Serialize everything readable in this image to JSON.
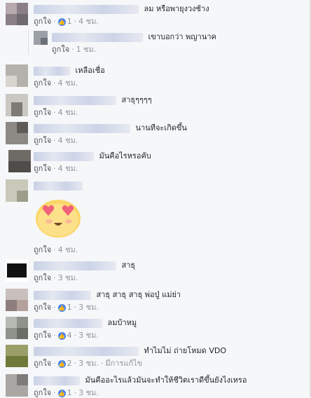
{
  "comments": [
    {
      "id": "c1",
      "text": "ลม หรือพายุงวงช้าง",
      "like": "ถูกใจ",
      "reactions": "1",
      "time": "4 ชม."
    },
    {
      "id": "c1r",
      "text": "เขาบอกว่า พญานาค",
      "like": "ถูกใจ",
      "time": "1 ชม."
    },
    {
      "id": "c2",
      "text": "เหลือเชื่อ",
      "like": "ถูกใจ",
      "time": "4 ชม."
    },
    {
      "id": "c3",
      "text": "สาธุๆๆๆๆ",
      "like": "ถูกใจ",
      "time": "4 ชม."
    },
    {
      "id": "c4",
      "text": "นานทีจะเกิดขึ้น",
      "like": "ถูกใจ",
      "time": "4 ชม."
    },
    {
      "id": "c5",
      "text": "มันคือไรหรอคับ",
      "like": "ถูกใจ",
      "time": "4 ชม."
    },
    {
      "id": "c6",
      "text": "",
      "like": "ถูกใจ",
      "time": "4 ชม.",
      "sticker": "heart-eyes-emoji"
    },
    {
      "id": "c7",
      "text": "สาธุ",
      "like": "ถูกใจ",
      "time": "3 ชม."
    },
    {
      "id": "c8",
      "text": "สาธุ สาธุ สาธุ พ่อปู่ แม่ย่า",
      "like": "ถูกใจ",
      "reactions": "1",
      "time": "3 ชม."
    },
    {
      "id": "c9",
      "text": "ลมบ้าหมู",
      "like": "ถูกใจ",
      "reactions": "4",
      "time": "3 ชม."
    },
    {
      "id": "c10",
      "text": "ทำไมไม่ ถ่ายโหมด VDO",
      "like": "ถูกใจ",
      "reactions": "2",
      "time": "3 ชม.",
      "edited": "มีการแก้ไข"
    },
    {
      "id": "c11",
      "text": "มันคืออะไรแล้วมันจะทำให้ชีวิตเราดีขึ้นยังไงเหรอ",
      "like": "ถูกใจ",
      "reactions": "1",
      "time": "3 ชม."
    }
  ],
  "sep": "·",
  "reaction_icon": "like-icon",
  "colors": {
    "link": "#4b4f56",
    "meta": "#90949c",
    "reaction": "#4080ff"
  }
}
